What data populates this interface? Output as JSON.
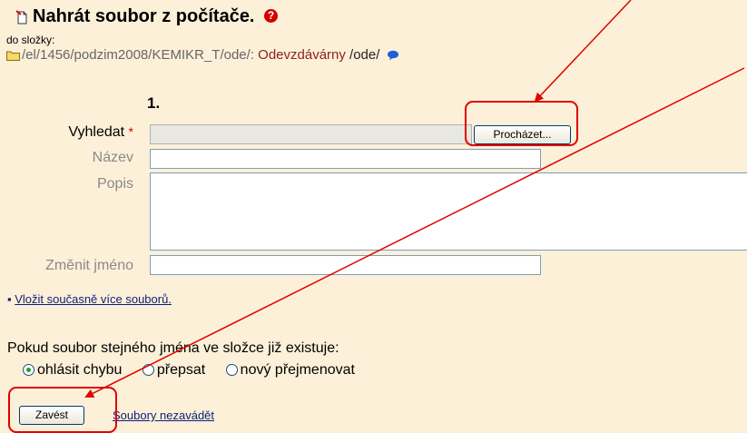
{
  "header": {
    "title": "Nahrát soubor z počítače.",
    "folder_label": "do složky:",
    "path_prefix": "/el/1456/podzim2008/KEMIKR_T/ode/:",
    "path_folder": "Odevzdávárny",
    "path_suffix": "/ode/"
  },
  "form": {
    "index": "1.",
    "browse_label": "Vyhledat",
    "required_mark": "*",
    "browse_button": "Procházet...",
    "name_label": "Název",
    "description_label": "Popis",
    "rename_label": "Změnit jméno",
    "multi_upload_link": "Vložit současně více souborů."
  },
  "conflict": {
    "question": "Pokud soubor stejného jména ve složce již existuje:",
    "options": [
      "ohlásit chybu",
      "přepsat",
      "nový přejmenovat"
    ],
    "selected": "ohlásit chybu"
  },
  "actions": {
    "submit_button": "Zavést",
    "cancel_link": "Soubory nezavádět"
  },
  "colors": {
    "background": "#fdf0d9",
    "annotation": "#e10000"
  },
  "icons": [
    "file-icon",
    "help-icon",
    "folder-icon",
    "speech-bubble-icon"
  ]
}
